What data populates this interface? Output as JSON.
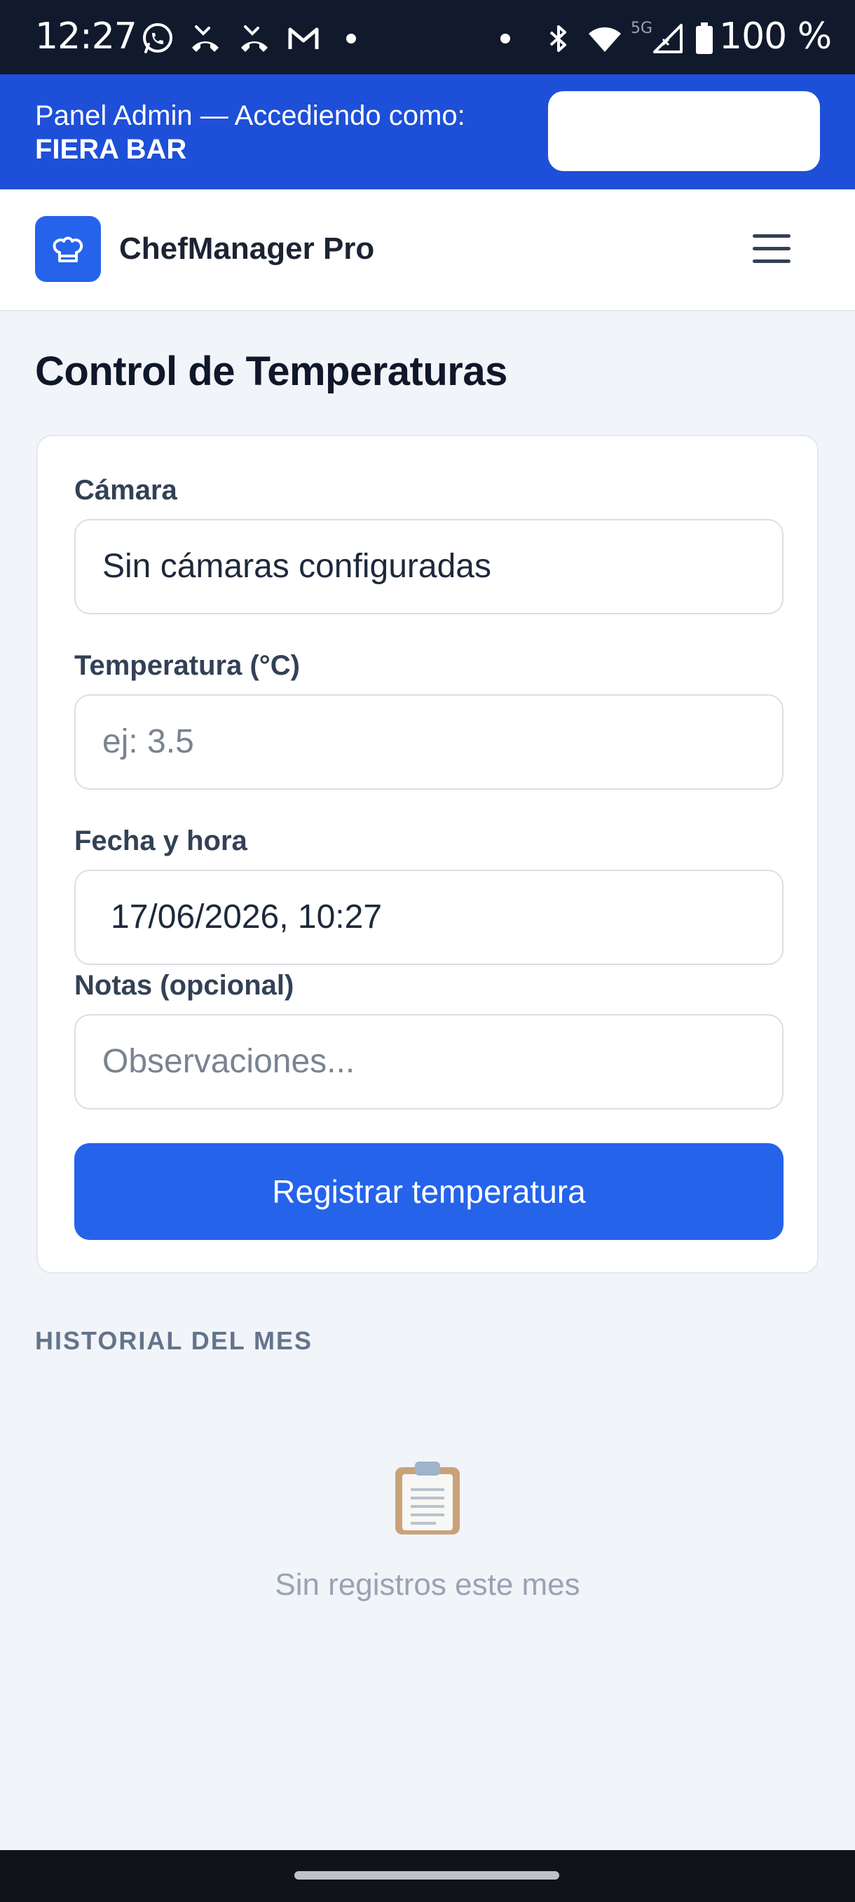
{
  "status_bar": {
    "time": "12:27",
    "network_label": "5G",
    "battery": "100 %",
    "icons": [
      "whatsapp-icon",
      "missed-call-icon",
      "missed-call-icon",
      "gmail-icon",
      "bluetooth-icon",
      "wifi-icon",
      "signal-icon",
      "battery-icon"
    ]
  },
  "admin_bar": {
    "line1": "Panel Admin — Accediendo como:",
    "line2": "FIERA BAR",
    "button_label": ""
  },
  "header": {
    "app_name": "ChefManager Pro",
    "logo_icon": "chef-hat-icon",
    "menu_icon": "hamburger-menu-icon"
  },
  "page": {
    "title": "Control de Temperaturas"
  },
  "form": {
    "camera_label": "Cámara",
    "camera_value": "Sin cámaras configuradas",
    "temperature_label": "Temperatura (°C)",
    "temperature_placeholder": "ej: 3.5",
    "datetime_label": "Fecha y hora",
    "datetime_value": "17/06/2026, 10:27",
    "notes_label": "Notas (opcional)",
    "notes_placeholder": "Observaciones...",
    "submit_label": "Registrar temperatura"
  },
  "history": {
    "heading": "HISTORIAL DEL MES",
    "empty_icon": "clipboard-icon",
    "empty_text": "Sin registros este mes"
  },
  "colors": {
    "status_bar_bg": "#111a2c",
    "admin_bar_bg": "#1d4fd8",
    "primary": "#2563eb",
    "page_bg": "#f1f4f8",
    "title_text": "#0f172a",
    "muted_text": "#64748b"
  }
}
